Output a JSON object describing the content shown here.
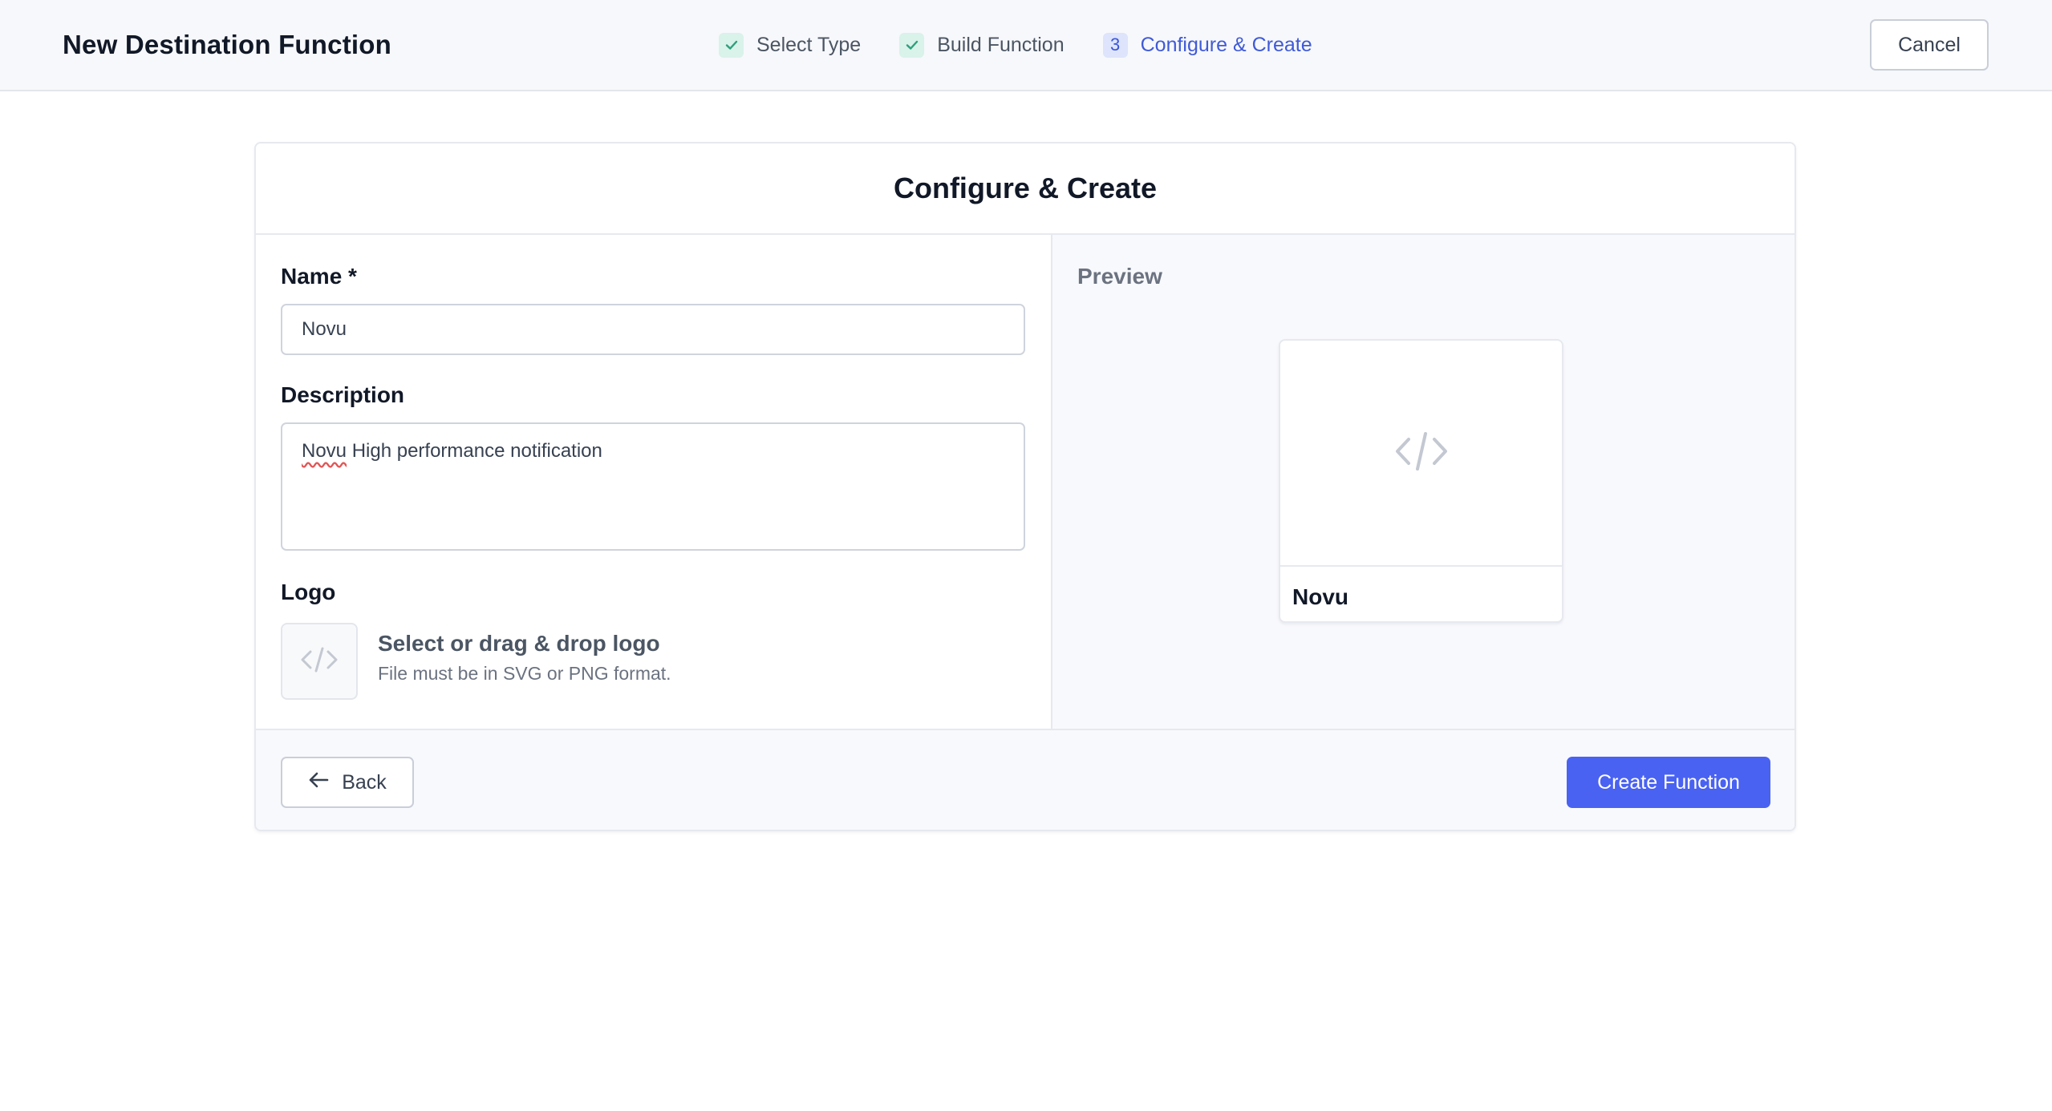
{
  "header": {
    "title": "New Destination Function",
    "steps": [
      {
        "label": "Select Type",
        "state": "done",
        "icon": "check-icon"
      },
      {
        "label": "Build Function",
        "state": "done",
        "icon": "check-icon"
      },
      {
        "label": "Configure & Create",
        "state": "active",
        "number": "3"
      }
    ],
    "cancel_label": "Cancel"
  },
  "card": {
    "title": "Configure & Create",
    "form": {
      "name_label": "Name *",
      "name_value": "Novu",
      "description_label": "Description",
      "description_value": "Novu High performance notification",
      "logo_label": "Logo",
      "logo_drop_title": "Select or drag & drop logo",
      "logo_drop_hint": "File must be in SVG or PNG format.",
      "logo_placeholder_icon": "code-icon"
    },
    "preview": {
      "label": "Preview",
      "name": "Novu",
      "icon": "code-icon"
    },
    "footer": {
      "back_label": "Back",
      "back_icon": "arrow-left-icon",
      "create_label": "Create Function"
    }
  },
  "colors": {
    "accent": "#4a62f1",
    "active_step": "#3f5ad8",
    "check_bg": "#d9f2ea",
    "check": "#2f9f7c"
  }
}
